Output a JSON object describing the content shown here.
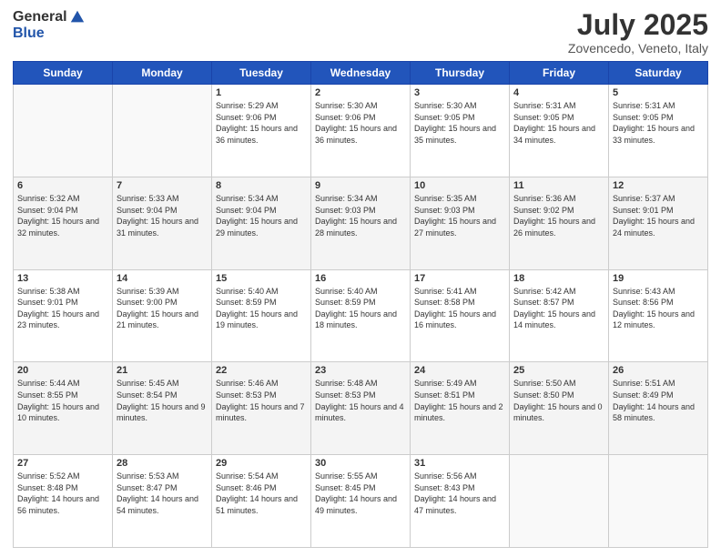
{
  "logo": {
    "general": "General",
    "blue": "Blue"
  },
  "title": "July 2025",
  "location": "Zovencedo, Veneto, Italy",
  "weekdays": [
    "Sunday",
    "Monday",
    "Tuesday",
    "Wednesday",
    "Thursday",
    "Friday",
    "Saturday"
  ],
  "weeks": [
    [
      {
        "day": "",
        "empty": true
      },
      {
        "day": "",
        "empty": true
      },
      {
        "day": "1",
        "sunrise": "Sunrise: 5:29 AM",
        "sunset": "Sunset: 9:06 PM",
        "daylight": "Daylight: 15 hours and 36 minutes."
      },
      {
        "day": "2",
        "sunrise": "Sunrise: 5:30 AM",
        "sunset": "Sunset: 9:06 PM",
        "daylight": "Daylight: 15 hours and 36 minutes."
      },
      {
        "day": "3",
        "sunrise": "Sunrise: 5:30 AM",
        "sunset": "Sunset: 9:05 PM",
        "daylight": "Daylight: 15 hours and 35 minutes."
      },
      {
        "day": "4",
        "sunrise": "Sunrise: 5:31 AM",
        "sunset": "Sunset: 9:05 PM",
        "daylight": "Daylight: 15 hours and 34 minutes."
      },
      {
        "day": "5",
        "sunrise": "Sunrise: 5:31 AM",
        "sunset": "Sunset: 9:05 PM",
        "daylight": "Daylight: 15 hours and 33 minutes."
      }
    ],
    [
      {
        "day": "6",
        "sunrise": "Sunrise: 5:32 AM",
        "sunset": "Sunset: 9:04 PM",
        "daylight": "Daylight: 15 hours and 32 minutes."
      },
      {
        "day": "7",
        "sunrise": "Sunrise: 5:33 AM",
        "sunset": "Sunset: 9:04 PM",
        "daylight": "Daylight: 15 hours and 31 minutes."
      },
      {
        "day": "8",
        "sunrise": "Sunrise: 5:34 AM",
        "sunset": "Sunset: 9:04 PM",
        "daylight": "Daylight: 15 hours and 29 minutes."
      },
      {
        "day": "9",
        "sunrise": "Sunrise: 5:34 AM",
        "sunset": "Sunset: 9:03 PM",
        "daylight": "Daylight: 15 hours and 28 minutes."
      },
      {
        "day": "10",
        "sunrise": "Sunrise: 5:35 AM",
        "sunset": "Sunset: 9:03 PM",
        "daylight": "Daylight: 15 hours and 27 minutes."
      },
      {
        "day": "11",
        "sunrise": "Sunrise: 5:36 AM",
        "sunset": "Sunset: 9:02 PM",
        "daylight": "Daylight: 15 hours and 26 minutes."
      },
      {
        "day": "12",
        "sunrise": "Sunrise: 5:37 AM",
        "sunset": "Sunset: 9:01 PM",
        "daylight": "Daylight: 15 hours and 24 minutes."
      }
    ],
    [
      {
        "day": "13",
        "sunrise": "Sunrise: 5:38 AM",
        "sunset": "Sunset: 9:01 PM",
        "daylight": "Daylight: 15 hours and 23 minutes."
      },
      {
        "day": "14",
        "sunrise": "Sunrise: 5:39 AM",
        "sunset": "Sunset: 9:00 PM",
        "daylight": "Daylight: 15 hours and 21 minutes."
      },
      {
        "day": "15",
        "sunrise": "Sunrise: 5:40 AM",
        "sunset": "Sunset: 8:59 PM",
        "daylight": "Daylight: 15 hours and 19 minutes."
      },
      {
        "day": "16",
        "sunrise": "Sunrise: 5:40 AM",
        "sunset": "Sunset: 8:59 PM",
        "daylight": "Daylight: 15 hours and 18 minutes."
      },
      {
        "day": "17",
        "sunrise": "Sunrise: 5:41 AM",
        "sunset": "Sunset: 8:58 PM",
        "daylight": "Daylight: 15 hours and 16 minutes."
      },
      {
        "day": "18",
        "sunrise": "Sunrise: 5:42 AM",
        "sunset": "Sunset: 8:57 PM",
        "daylight": "Daylight: 15 hours and 14 minutes."
      },
      {
        "day": "19",
        "sunrise": "Sunrise: 5:43 AM",
        "sunset": "Sunset: 8:56 PM",
        "daylight": "Daylight: 15 hours and 12 minutes."
      }
    ],
    [
      {
        "day": "20",
        "sunrise": "Sunrise: 5:44 AM",
        "sunset": "Sunset: 8:55 PM",
        "daylight": "Daylight: 15 hours and 10 minutes."
      },
      {
        "day": "21",
        "sunrise": "Sunrise: 5:45 AM",
        "sunset": "Sunset: 8:54 PM",
        "daylight": "Daylight: 15 hours and 9 minutes."
      },
      {
        "day": "22",
        "sunrise": "Sunrise: 5:46 AM",
        "sunset": "Sunset: 8:53 PM",
        "daylight": "Daylight: 15 hours and 7 minutes."
      },
      {
        "day": "23",
        "sunrise": "Sunrise: 5:48 AM",
        "sunset": "Sunset: 8:53 PM",
        "daylight": "Daylight: 15 hours and 4 minutes."
      },
      {
        "day": "24",
        "sunrise": "Sunrise: 5:49 AM",
        "sunset": "Sunset: 8:51 PM",
        "daylight": "Daylight: 15 hours and 2 minutes."
      },
      {
        "day": "25",
        "sunrise": "Sunrise: 5:50 AM",
        "sunset": "Sunset: 8:50 PM",
        "daylight": "Daylight: 15 hours and 0 minutes."
      },
      {
        "day": "26",
        "sunrise": "Sunrise: 5:51 AM",
        "sunset": "Sunset: 8:49 PM",
        "daylight": "Daylight: 14 hours and 58 minutes."
      }
    ],
    [
      {
        "day": "27",
        "sunrise": "Sunrise: 5:52 AM",
        "sunset": "Sunset: 8:48 PM",
        "daylight": "Daylight: 14 hours and 56 minutes."
      },
      {
        "day": "28",
        "sunrise": "Sunrise: 5:53 AM",
        "sunset": "Sunset: 8:47 PM",
        "daylight": "Daylight: 14 hours and 54 minutes."
      },
      {
        "day": "29",
        "sunrise": "Sunrise: 5:54 AM",
        "sunset": "Sunset: 8:46 PM",
        "daylight": "Daylight: 14 hours and 51 minutes."
      },
      {
        "day": "30",
        "sunrise": "Sunrise: 5:55 AM",
        "sunset": "Sunset: 8:45 PM",
        "daylight": "Daylight: 14 hours and 49 minutes."
      },
      {
        "day": "31",
        "sunrise": "Sunrise: 5:56 AM",
        "sunset": "Sunset: 8:43 PM",
        "daylight": "Daylight: 14 hours and 47 minutes."
      },
      {
        "day": "",
        "empty": true
      },
      {
        "day": "",
        "empty": true
      }
    ]
  ]
}
